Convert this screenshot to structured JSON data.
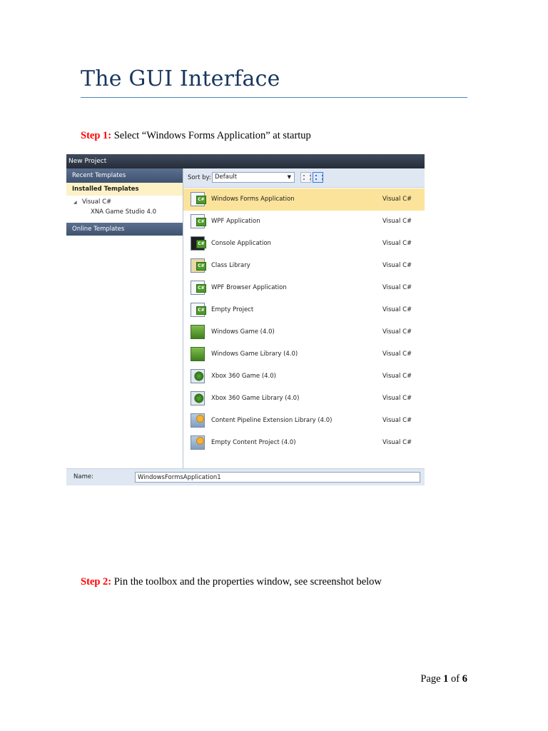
{
  "document": {
    "title": "The GUI Interface",
    "step1": {
      "label": "Step 1:",
      "text": "Select “Windows Forms Application” at startup"
    },
    "step2": {
      "label": "Step 2:",
      "text": "Pin the toolbox and the properties window, see screenshot below"
    },
    "footer": {
      "page_word": "Page",
      "current": "1",
      "of_word": "of",
      "total": "6"
    }
  },
  "dialog": {
    "title": "New Project",
    "left_pane": {
      "recent": "Recent Templates",
      "installed": "Installed Templates",
      "tree": {
        "language": "Visual C#",
        "child": "XNA Game Studio 4.0"
      },
      "online": "Online Templates"
    },
    "sort": {
      "label": "Sort by:",
      "value": "Default"
    },
    "templates": [
      {
        "name": "Windows Forms Application",
        "lang": "Visual C#",
        "icon": "winforms-icon",
        "selected": true
      },
      {
        "name": "WPF Application",
        "lang": "Visual C#",
        "icon": "wpf-icon"
      },
      {
        "name": "Console Application",
        "lang": "Visual C#",
        "icon": "console-icon"
      },
      {
        "name": "Class Library",
        "lang": "Visual C#",
        "icon": "class-library-icon"
      },
      {
        "name": "WPF Browser Application",
        "lang": "Visual C#",
        "icon": "wpf-browser-icon"
      },
      {
        "name": "Empty Project",
        "lang": "Visual C#",
        "icon": "empty-project-icon"
      },
      {
        "name": "Windows Game (4.0)",
        "lang": "Visual C#",
        "icon": "windows-game-icon"
      },
      {
        "name": "Windows Game Library (4.0)",
        "lang": "Visual C#",
        "icon": "windows-game-library-icon"
      },
      {
        "name": "Xbox 360 Game (4.0)",
        "lang": "Visual C#",
        "icon": "xbox-game-icon"
      },
      {
        "name": "Xbox 360 Game Library (4.0)",
        "lang": "Visual C#",
        "icon": "xbox-game-library-icon"
      },
      {
        "name": "Content Pipeline Extension Library (4.0)",
        "lang": "Visual C#",
        "icon": "content-pipeline-icon"
      },
      {
        "name": "Empty Content Project (4.0)",
        "lang": "Visual C#",
        "icon": "empty-content-icon"
      }
    ],
    "name_field": {
      "label": "Name:",
      "value": "WindowsFormsApplication1"
    }
  }
}
